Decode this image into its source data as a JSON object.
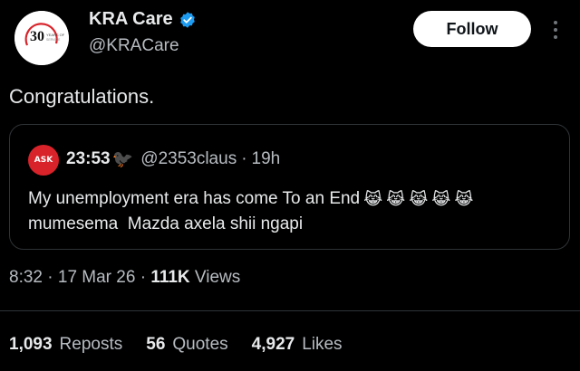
{
  "author": {
    "display_name": "KRA Care",
    "handle": "@KRACare",
    "verified_icon": "verified-badge-icon",
    "avatar_icon": "kra-30-years-logo"
  },
  "follow_label": "Follow",
  "tweet_text": "Congratulations.",
  "quoted": {
    "avatar_text": "ASK",
    "display_name": "23:53",
    "name_emoji": "🐦‍⬛",
    "handle": "@2353claus",
    "separator": "·",
    "time": "19h",
    "line1": "My unemployment era has come To an End",
    "line1_emojis": [
      "😹",
      "😹",
      "😹",
      "😹",
      "😹"
    ],
    "line2": "mumesema  Mazda axela shii ngapi"
  },
  "meta": {
    "time": "8:32",
    "sep": "·",
    "date": "17 Mar 26",
    "views_count": "111K",
    "views_label": "Views"
  },
  "stats": {
    "reposts_count": "1,093",
    "reposts_label": "Reposts",
    "quotes_count": "56",
    "quotes_label": "Quotes",
    "likes_count": "4,927",
    "likes_label": "Likes"
  },
  "colors": {
    "background": "#000000",
    "text": "#e7e9ea",
    "secondary": "#b7bcc1",
    "verified": "#1d9bf0",
    "kra_red": "#d8232a"
  }
}
